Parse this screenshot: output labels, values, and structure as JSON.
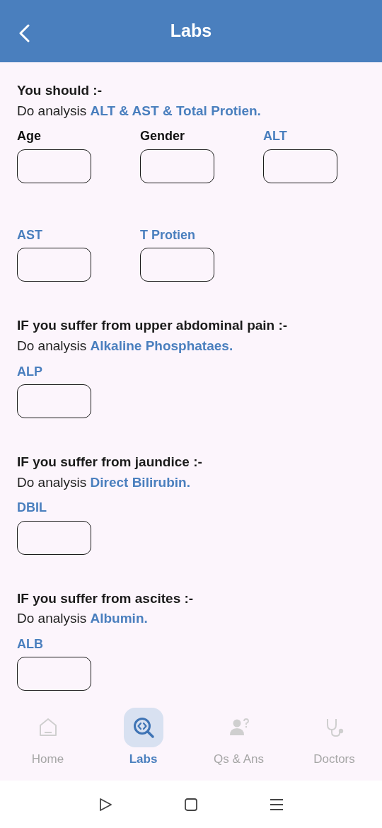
{
  "header": {
    "title": "Labs"
  },
  "sections": [
    {
      "heading": "You should :-",
      "sentence": "Do analysis **ALT & AST & Total Protien.**",
      "fields": [
        {
          "label": "Age",
          "highlighted": false
        },
        {
          "label": "Gender",
          "highlighted": false
        },
        {
          "label": "ALT",
          "highlighted": true
        },
        {
          "label": "AST",
          "highlighted": true
        },
        {
          "label": "T Protien",
          "highlighted": true
        }
      ]
    },
    {
      "heading": "IF you suffer from upper abdominal pain :-",
      "sentence": "Do analysis **Alkaline Phosphataes.**",
      "fields": [
        {
          "label": "ALP",
          "highlighted": true
        }
      ]
    },
    {
      "heading": "IF you suffer from jaundice :-",
      "sentence": "Do analysis **Direct Bilirubin.**",
      "fields": [
        {
          "label": "DBIL",
          "highlighted": true
        }
      ]
    },
    {
      "heading": "IF you suffer from ascites :-",
      "sentence": "Do analysis **Albumin.**",
      "fields": [
        {
          "label": "ALB",
          "highlighted": true
        }
      ]
    }
  ],
  "bottom_nav": [
    {
      "label": "Home",
      "selected": false
    },
    {
      "label": "Labs",
      "selected": true
    },
    {
      "label": "Qs & Ans",
      "selected": false
    },
    {
      "label": "Doctors",
      "selected": false
    }
  ]
}
